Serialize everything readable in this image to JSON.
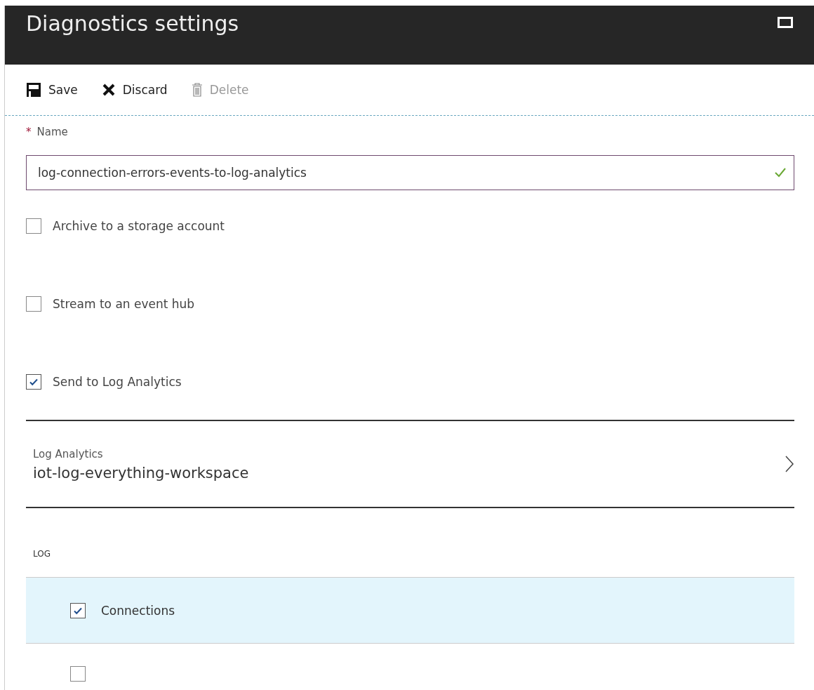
{
  "blade": {
    "title": "Diagnostics settings"
  },
  "toolbar": [
    {
      "label": "Save",
      "kind": "save",
      "disabled": false
    },
    {
      "label": "Discard",
      "kind": "discard",
      "disabled": false
    },
    {
      "label": "Delete",
      "kind": "delete",
      "disabled": true
    }
  ],
  "name_field": {
    "label": "Name",
    "required_mark": "*",
    "value": "log-connection-errors-events-to-log-analytics",
    "valid": true
  },
  "destinations": [
    {
      "label": "Archive to a storage account",
      "checked": false
    },
    {
      "label": "Stream to an event hub",
      "checked": false
    },
    {
      "label": "Send to Log Analytics",
      "checked": true
    }
  ],
  "workspace": {
    "label": "Log Analytics",
    "value": "iot-log-everything-workspace"
  },
  "log": {
    "heading": "LOG",
    "rows": [
      {
        "label": "Connections",
        "checked": true,
        "selected": true
      },
      {
        "checked": false,
        "selected": false
      }
    ]
  }
}
